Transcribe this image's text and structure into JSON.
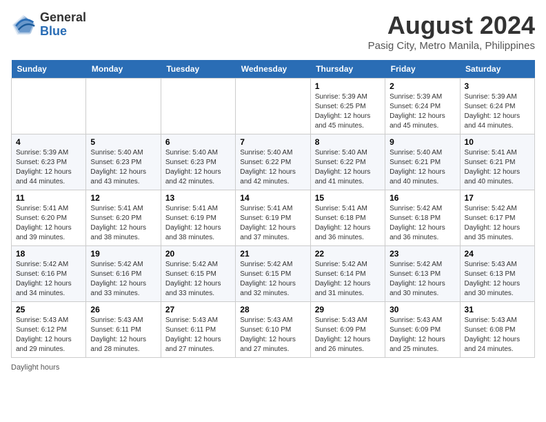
{
  "header": {
    "logo_general": "General",
    "logo_blue": "Blue",
    "month_year": "August 2024",
    "location": "Pasig City, Metro Manila, Philippines"
  },
  "weekdays": [
    "Sunday",
    "Monday",
    "Tuesday",
    "Wednesday",
    "Thursday",
    "Friday",
    "Saturday"
  ],
  "weeks": [
    [
      {
        "day": "",
        "info": ""
      },
      {
        "day": "",
        "info": ""
      },
      {
        "day": "",
        "info": ""
      },
      {
        "day": "",
        "info": ""
      },
      {
        "day": "1",
        "info": "Sunrise: 5:39 AM\nSunset: 6:25 PM\nDaylight: 12 hours and 45 minutes."
      },
      {
        "day": "2",
        "info": "Sunrise: 5:39 AM\nSunset: 6:24 PM\nDaylight: 12 hours and 45 minutes."
      },
      {
        "day": "3",
        "info": "Sunrise: 5:39 AM\nSunset: 6:24 PM\nDaylight: 12 hours and 44 minutes."
      }
    ],
    [
      {
        "day": "4",
        "info": "Sunrise: 5:39 AM\nSunset: 6:23 PM\nDaylight: 12 hours and 44 minutes."
      },
      {
        "day": "5",
        "info": "Sunrise: 5:40 AM\nSunset: 6:23 PM\nDaylight: 12 hours and 43 minutes."
      },
      {
        "day": "6",
        "info": "Sunrise: 5:40 AM\nSunset: 6:23 PM\nDaylight: 12 hours and 42 minutes."
      },
      {
        "day": "7",
        "info": "Sunrise: 5:40 AM\nSunset: 6:22 PM\nDaylight: 12 hours and 42 minutes."
      },
      {
        "day": "8",
        "info": "Sunrise: 5:40 AM\nSunset: 6:22 PM\nDaylight: 12 hours and 41 minutes."
      },
      {
        "day": "9",
        "info": "Sunrise: 5:40 AM\nSunset: 6:21 PM\nDaylight: 12 hours and 40 minutes."
      },
      {
        "day": "10",
        "info": "Sunrise: 5:41 AM\nSunset: 6:21 PM\nDaylight: 12 hours and 40 minutes."
      }
    ],
    [
      {
        "day": "11",
        "info": "Sunrise: 5:41 AM\nSunset: 6:20 PM\nDaylight: 12 hours and 39 minutes."
      },
      {
        "day": "12",
        "info": "Sunrise: 5:41 AM\nSunset: 6:20 PM\nDaylight: 12 hours and 38 minutes."
      },
      {
        "day": "13",
        "info": "Sunrise: 5:41 AM\nSunset: 6:19 PM\nDaylight: 12 hours and 38 minutes."
      },
      {
        "day": "14",
        "info": "Sunrise: 5:41 AM\nSunset: 6:19 PM\nDaylight: 12 hours and 37 minutes."
      },
      {
        "day": "15",
        "info": "Sunrise: 5:41 AM\nSunset: 6:18 PM\nDaylight: 12 hours and 36 minutes."
      },
      {
        "day": "16",
        "info": "Sunrise: 5:42 AM\nSunset: 6:18 PM\nDaylight: 12 hours and 36 minutes."
      },
      {
        "day": "17",
        "info": "Sunrise: 5:42 AM\nSunset: 6:17 PM\nDaylight: 12 hours and 35 minutes."
      }
    ],
    [
      {
        "day": "18",
        "info": "Sunrise: 5:42 AM\nSunset: 6:16 PM\nDaylight: 12 hours and 34 minutes."
      },
      {
        "day": "19",
        "info": "Sunrise: 5:42 AM\nSunset: 6:16 PM\nDaylight: 12 hours and 33 minutes."
      },
      {
        "day": "20",
        "info": "Sunrise: 5:42 AM\nSunset: 6:15 PM\nDaylight: 12 hours and 33 minutes."
      },
      {
        "day": "21",
        "info": "Sunrise: 5:42 AM\nSunset: 6:15 PM\nDaylight: 12 hours and 32 minutes."
      },
      {
        "day": "22",
        "info": "Sunrise: 5:42 AM\nSunset: 6:14 PM\nDaylight: 12 hours and 31 minutes."
      },
      {
        "day": "23",
        "info": "Sunrise: 5:42 AM\nSunset: 6:13 PM\nDaylight: 12 hours and 30 minutes."
      },
      {
        "day": "24",
        "info": "Sunrise: 5:43 AM\nSunset: 6:13 PM\nDaylight: 12 hours and 30 minutes."
      }
    ],
    [
      {
        "day": "25",
        "info": "Sunrise: 5:43 AM\nSunset: 6:12 PM\nDaylight: 12 hours and 29 minutes."
      },
      {
        "day": "26",
        "info": "Sunrise: 5:43 AM\nSunset: 6:11 PM\nDaylight: 12 hours and 28 minutes."
      },
      {
        "day": "27",
        "info": "Sunrise: 5:43 AM\nSunset: 6:11 PM\nDaylight: 12 hours and 27 minutes."
      },
      {
        "day": "28",
        "info": "Sunrise: 5:43 AM\nSunset: 6:10 PM\nDaylight: 12 hours and 27 minutes."
      },
      {
        "day": "29",
        "info": "Sunrise: 5:43 AM\nSunset: 6:09 PM\nDaylight: 12 hours and 26 minutes."
      },
      {
        "day": "30",
        "info": "Sunrise: 5:43 AM\nSunset: 6:09 PM\nDaylight: 12 hours and 25 minutes."
      },
      {
        "day": "31",
        "info": "Sunrise: 5:43 AM\nSunset: 6:08 PM\nDaylight: 12 hours and 24 minutes."
      }
    ]
  ],
  "footer": {
    "note": "Daylight hours"
  }
}
